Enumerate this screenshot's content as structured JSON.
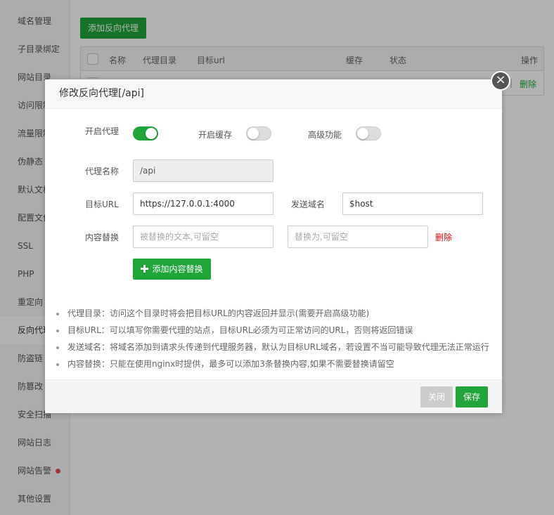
{
  "sidebar": {
    "items": [
      {
        "label": "域名管理"
      },
      {
        "label": "子目录绑定"
      },
      {
        "label": "网站目录"
      },
      {
        "label": "访问限制"
      },
      {
        "label": "流量限制"
      },
      {
        "label": "伪静态"
      },
      {
        "label": "默认文档"
      },
      {
        "label": "配置文件"
      },
      {
        "label": "SSL"
      },
      {
        "label": "PHP"
      },
      {
        "label": "重定向"
      },
      {
        "label": "反向代理"
      },
      {
        "label": "防盗链"
      },
      {
        "label": "防篡改"
      },
      {
        "label": "安全扫描"
      },
      {
        "label": "网站日志"
      },
      {
        "label": "网站告警"
      },
      {
        "label": "其他设置"
      }
    ],
    "active_index": 11,
    "alert_dot_index": 16
  },
  "main": {
    "add_button": "添加反向代理",
    "table": {
      "headers": [
        "名称",
        "代理目录",
        "目标url",
        "缓存",
        "状态",
        "操作"
      ],
      "row_action": "删除"
    }
  },
  "modal": {
    "title": "修改反向代理[/api]",
    "close_icon": "×",
    "toggles": [
      {
        "label": "开启代理",
        "on": true
      },
      {
        "label": "开启缓存",
        "on": false
      },
      {
        "label": "高级功能",
        "on": false
      }
    ],
    "proxy_name_label": "代理名称",
    "proxy_name_value": "/api",
    "target_url_label": "目标URL",
    "target_url_value": "https://127.0.0.1:4000",
    "send_domain_label": "发送域名",
    "send_domain_value": "$host",
    "content_replace_label": "内容替换",
    "replace_from_placeholder": "被替换的文本,可留空",
    "replace_to_placeholder": "替换为,可留空",
    "replace_delete": "删除",
    "add_replace_button": "添加内容替换",
    "help": [
      "代理目录：访问这个目录时将会把目标URL的内容返回并显示(需要开启高级功能)",
      "目标URL：可以填写你需要代理的站点，目标URL必须为可正常访问的URL，否则将返回错误",
      "发送域名：将域名添加到请求头传递到代理服务器，默认为目标URL域名，若设置不当可能导致代理无法正常运行",
      "内容替换：只能在使用nginx时提供，最多可以添加3条替换内容,如果不需要替换请留空"
    ],
    "footer": {
      "close_label": "关闭",
      "save_label": "保存"
    }
  },
  "colors": {
    "accent": "#20a53a",
    "danger": "#ef0808"
  }
}
